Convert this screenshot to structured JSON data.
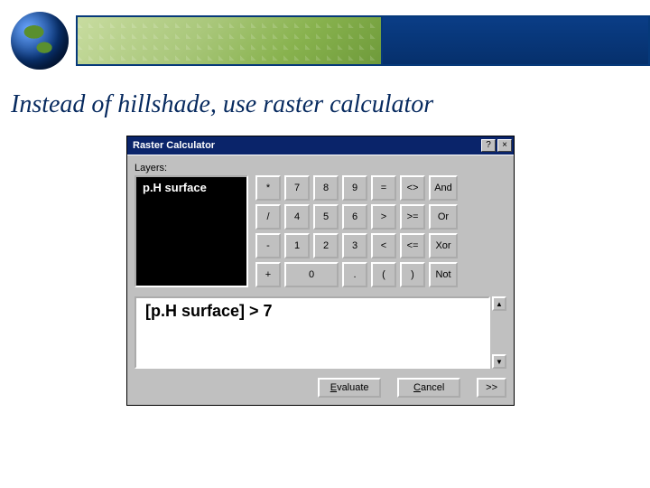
{
  "slide": {
    "title": "Instead of hillshade, use raster calculator"
  },
  "dialog": {
    "title": "Raster Calculator",
    "layers_label": "Layers:",
    "layers": [
      {
        "name": "p.H surface"
      }
    ],
    "keypad": {
      "row1": [
        "*",
        "7",
        "8",
        "9",
        "=",
        "<>",
        "And"
      ],
      "row2": [
        "/",
        "4",
        "5",
        "6",
        ">",
        ">=",
        "Or"
      ],
      "row3": [
        "-",
        "1",
        "2",
        "3",
        "<",
        "<=",
        "Xor"
      ],
      "row4": [
        "+",
        "0",
        ".",
        "(",
        ")",
        "Not"
      ]
    },
    "expression": "[p.H surface] > 7",
    "buttons": {
      "evaluate": "Evaluate",
      "cancel": "Cancel",
      "expand": ">>"
    },
    "titlebar_icons": {
      "help": "?",
      "close": "×"
    }
  }
}
